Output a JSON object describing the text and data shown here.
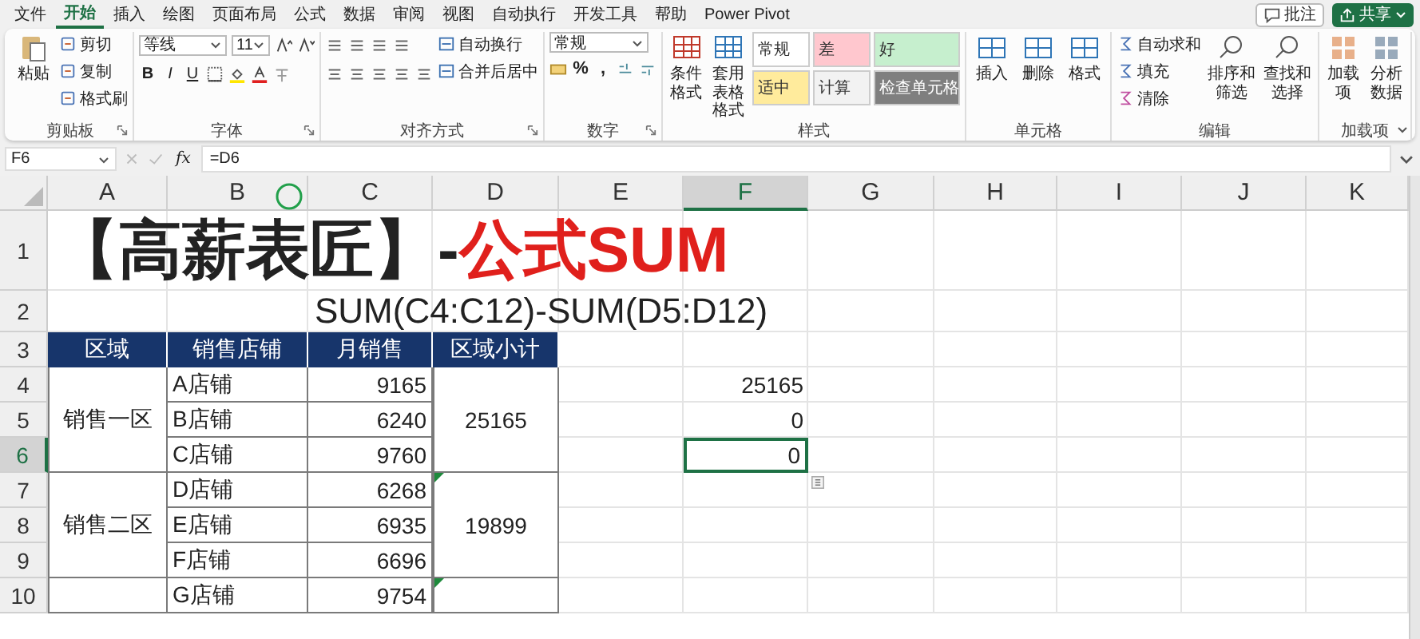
{
  "tabs": [
    {
      "label": "文件",
      "selected": false
    },
    {
      "label": "开始",
      "selected": true
    },
    {
      "label": "插入",
      "selected": false
    },
    {
      "label": "绘图",
      "selected": false
    },
    {
      "label": "页面布局",
      "selected": false
    },
    {
      "label": "公式",
      "selected": false
    },
    {
      "label": "数据",
      "selected": false
    },
    {
      "label": "审阅",
      "selected": false
    },
    {
      "label": "视图",
      "selected": false
    },
    {
      "label": "自动执行",
      "selected": false
    },
    {
      "label": "开发工具",
      "selected": false
    },
    {
      "label": "帮助",
      "selected": false
    },
    {
      "label": "Power Pivot",
      "selected": false
    }
  ],
  "top_buttons": {
    "comments": "批注",
    "share": "共享"
  },
  "ribbon": {
    "groups": [
      {
        "kind": "clipboard",
        "label": "剪贴板",
        "launcher": true,
        "paste": "粘贴",
        "items": [
          "剪切",
          "复制",
          "格式刷"
        ]
      },
      {
        "kind": "font",
        "label": "字体",
        "launcher": true,
        "font_name": "等线",
        "font_size": "11",
        "styles": [
          "B",
          "I",
          "U"
        ]
      },
      {
        "kind": "alignment",
        "label": "对齐方式",
        "launcher": true,
        "items": [
          "自动换行",
          "合并后居中"
        ]
      },
      {
        "kind": "number",
        "label": "数字",
        "launcher": true,
        "format": "常规",
        "symbols": [
          "%",
          ","
        ]
      },
      {
        "kind": "styles",
        "label": "样式",
        "launcher": false,
        "buttons": [
          "条件格式",
          "套用表格格式"
        ],
        "cell_styles": [
          {
            "label": "常规",
            "color": "#ffffff"
          },
          {
            "label": "差",
            "color": "#ffc7ce"
          },
          {
            "label": "好",
            "color": "#c6efce"
          },
          {
            "label": "适中",
            "color": "#ffeb9c"
          },
          {
            "label": "计算",
            "color": "#f2f2f2"
          },
          {
            "label": "检查单元格",
            "color": "#7f7f7f"
          }
        ]
      },
      {
        "kind": "cells",
        "label": "单元格",
        "launcher": false,
        "items": [
          "插入",
          "删除",
          "格式"
        ]
      },
      {
        "kind": "editing",
        "label": "编辑",
        "launcher": false,
        "items": [
          "自动求和",
          "填充",
          "清除"
        ],
        "big": [
          "排序和筛选",
          "查找和选择"
        ]
      },
      {
        "kind": "addins",
        "label": "加载项",
        "launcher": false,
        "items": [
          "加载项",
          "分析数据"
        ]
      }
    ]
  },
  "formula_bar": {
    "name_box": "F6",
    "function_label": "fx",
    "formula": "=D6"
  },
  "sheet": {
    "columns": [
      {
        "label": "A",
        "selected": false
      },
      {
        "label": "B",
        "selected": false
      },
      {
        "label": "C",
        "selected": false
      },
      {
        "label": "D",
        "selected": false
      },
      {
        "label": "E",
        "selected": false
      },
      {
        "label": "F",
        "selected": true
      },
      {
        "label": "G",
        "selected": false
      },
      {
        "label": "H",
        "selected": false
      },
      {
        "label": "I",
        "selected": false
      },
      {
        "label": "J",
        "selected": false
      },
      {
        "label": "K",
        "selected": false
      }
    ],
    "rows": [
      {
        "label": "1",
        "selected": false
      },
      {
        "label": "2",
        "selected": false
      },
      {
        "label": "3",
        "selected": false
      },
      {
        "label": "4",
        "selected": false
      },
      {
        "label": "5",
        "selected": false
      },
      {
        "label": "6",
        "selected": true
      },
      {
        "label": "7",
        "selected": false
      },
      {
        "label": "8",
        "selected": false
      },
      {
        "label": "9",
        "selected": false
      },
      {
        "label": "10",
        "selected": false
      }
    ],
    "title": {
      "text": "【高薪表匠】-",
      "highlight": "公式SUM"
    },
    "formula_note": "SUM(C4:C12)-SUM(D5:D12)",
    "table": {
      "headers": [
        "区域",
        "销售店铺",
        "月销售",
        "区域小计"
      ],
      "groups": [
        {
          "region": "销售一区",
          "subtotal": "25165",
          "error_flag": false,
          "stores": [
            {
              "store": "A店铺",
              "sales": "9165"
            },
            {
              "store": "B店铺",
              "sales": "6240"
            },
            {
              "store": "C店铺",
              "sales": "9760"
            }
          ]
        },
        {
          "region": "销售二区",
          "subtotal": "19899",
          "error_flag": true,
          "stores": [
            {
              "store": "D店铺",
              "sales": "6268"
            },
            {
              "store": "E店铺",
              "sales": "6935"
            },
            {
              "store": "F店铺",
              "sales": "6696"
            }
          ]
        },
        {
          "error_flag": true,
          "stores": [
            {
              "store": "G店铺",
              "sales": "9754"
            }
          ]
        }
      ]
    },
    "results": [
      {
        "value": "25165",
        "selected": false
      },
      {
        "value": "0",
        "selected": false
      },
      {
        "value": "0",
        "selected": true
      }
    ]
  }
}
